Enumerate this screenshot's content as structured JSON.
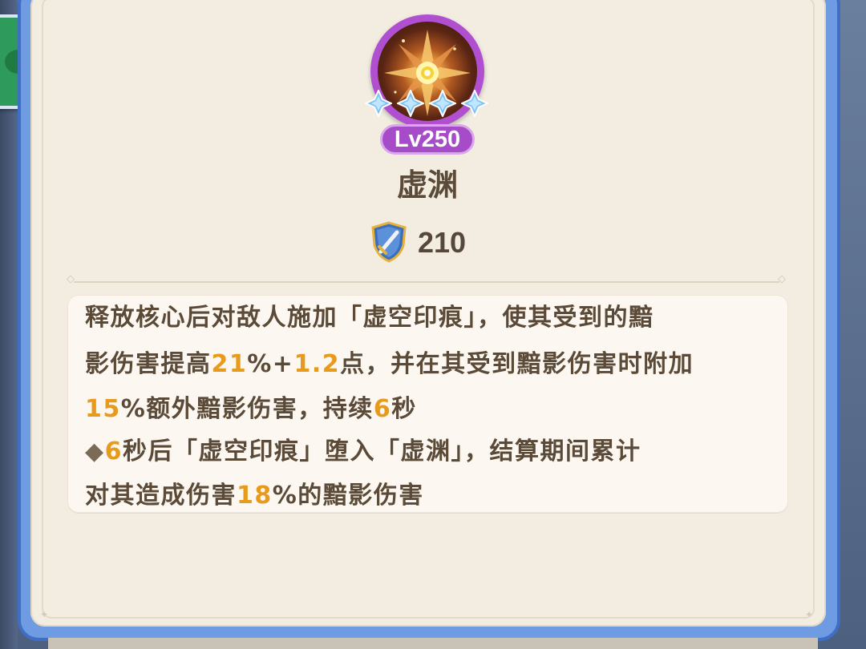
{
  "skill": {
    "level_label": "Lv250",
    "name": "虚渊",
    "power_value": "210",
    "stars": 4
  },
  "description": {
    "lines": [
      [
        {
          "t": "释放核心后对敌人施加「虚空印痕」，使其受到的黯"
        }
      ],
      [
        {
          "t": "影伤害提高"
        },
        {
          "t": "21",
          "hl": true
        },
        {
          "t": "%+"
        },
        {
          "t": "1.2",
          "hl": true
        },
        {
          "t": "点，并在其受到黯影伤害时附加"
        }
      ],
      [
        {
          "t": "15",
          "hl": true
        },
        {
          "t": "%额外黯影伤害，持续"
        },
        {
          "t": "6",
          "hl": true
        },
        {
          "t": "秒"
        }
      ],
      [
        {
          "t": "◆",
          "bullet": true
        },
        {
          "t": "6",
          "hl": true
        },
        {
          "t": "秒后「虚空印痕」堕入「虚渊」，结算期间累计"
        }
      ],
      [
        {
          "t": "对其造成伤害"
        },
        {
          "t": "18",
          "hl": true
        },
        {
          "t": "%的黯影伤害"
        }
      ]
    ]
  },
  "colors": {
    "panel_bg": "#f2ece1",
    "frame_blue": "#6f9be3",
    "level_purple": "#a64cc9",
    "highlight_orange": "#e79a1c",
    "text_brown": "#5a4a37"
  },
  "icons": {
    "skill": "radiant-star-burst-icon",
    "gem": "blue-diamond-star-icon",
    "power": "shield-sword-icon",
    "side": "chat-bubble-icon"
  }
}
